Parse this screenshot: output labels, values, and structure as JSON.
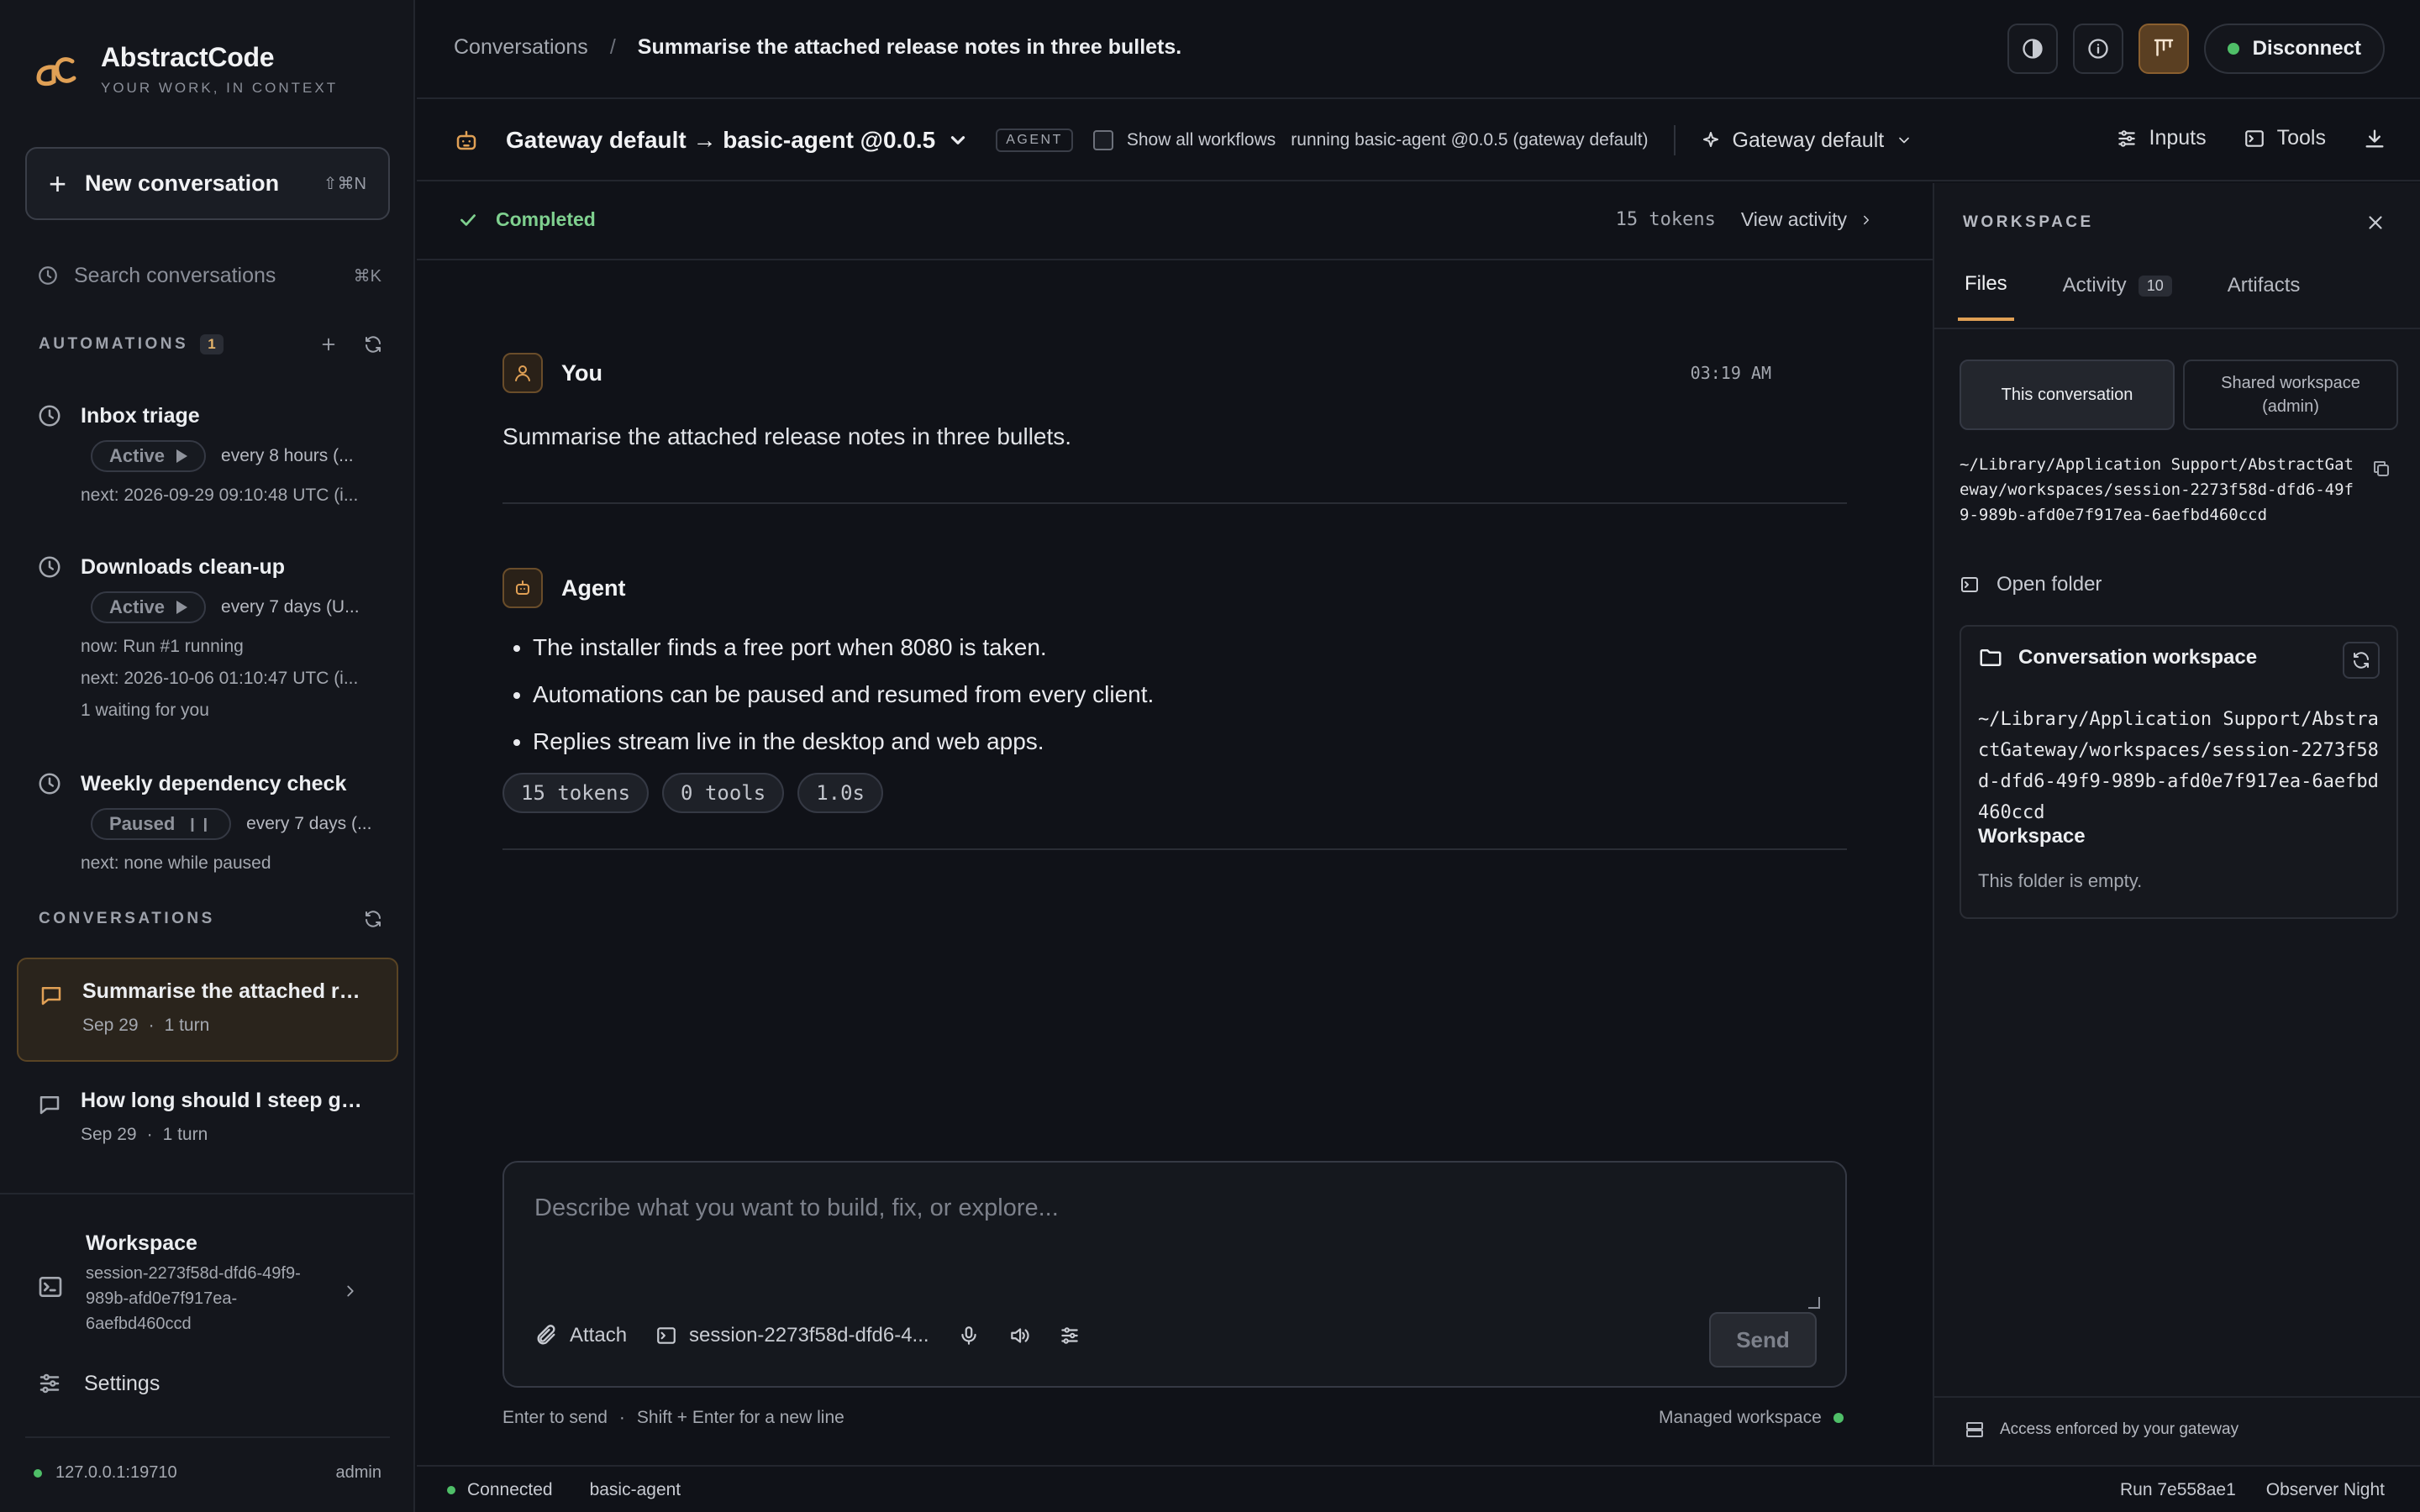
{
  "brand": {
    "name": "AbstractCode",
    "tagline": "YOUR WORK, IN CONTEXT"
  },
  "sidebar": {
    "new_conversation": {
      "label": "New conversation",
      "shortcut": "⇧⌘N"
    },
    "search": {
      "placeholder": "Search conversations",
      "shortcut": "⌘K"
    },
    "automations": {
      "heading": "AUTOMATIONS",
      "count": "1",
      "items": [
        {
          "title": "Inbox triage",
          "status": "Active",
          "schedule": "every 8 hours (...",
          "lines": [
            "next: 2026-09-29 09:10:48 UTC (i..."
          ]
        },
        {
          "title": "Downloads clean-up",
          "status": "Active",
          "schedule": "every 7 days (U...",
          "lines": [
            "now: Run #1 running",
            "next: 2026-10-06 01:10:47 UTC (i...",
            "1 waiting for you"
          ]
        },
        {
          "title": "Weekly dependency check",
          "status": "Paused",
          "schedule": "every 7 days (...",
          "lines": [
            "next: none while paused"
          ]
        }
      ]
    },
    "conversations": {
      "heading": "CONVERSATIONS",
      "items": [
        {
          "title": "Summarise the attached rel...",
          "date": "Sep 29",
          "turns": "1 turn"
        },
        {
          "title": "How long should I steep gre...",
          "date": "Sep 29",
          "turns": "1 turn"
        }
      ]
    },
    "workspace": {
      "title": "Workspace",
      "path": "session-2273f58d-dfd6-49f9-989b-afd0e7f917ea-6aefbd460ccd"
    },
    "settings_label": "Settings",
    "footer": {
      "host": "127.0.0.1:19710",
      "user": "admin"
    }
  },
  "topbar": {
    "breadcrumb_root": "Conversations",
    "breadcrumb_sep": "/",
    "breadcrumb_current": "Summarise the attached release notes in three bullets.",
    "disconnect_label": "Disconnect"
  },
  "agentbar": {
    "agent_name": "Gateway default → basic-agent @0.0.5",
    "badge": "AGENT",
    "show_all_label": "Show all workflows",
    "running_label": "running basic-agent @0.0.5 (gateway default)",
    "gateway_label": "Gateway default",
    "inputs_label": "Inputs",
    "tools_label": "Tools"
  },
  "statusbar": {
    "status": "Completed",
    "tokens": "15 tokens",
    "view_activity": "View activity"
  },
  "messages": {
    "user": {
      "role": "You",
      "time": "03:19 AM",
      "text": "Summarise the attached release notes in three bullets."
    },
    "agent": {
      "role": "Agent",
      "bullets": [
        "The installer finds a free port when 8080 is taken.",
        "Automations can be paused and resumed from every client.",
        "Replies stream live in the desktop and web apps."
      ],
      "chips": [
        "15 tokens",
        "0 tools",
        "1.0s"
      ]
    }
  },
  "composer": {
    "placeholder": "Describe what you want to build, fix, or explore...",
    "attach_label": "Attach",
    "session_label": "session-2273f58d-dfd6-4...",
    "send_label": "Send",
    "hint_send": "Enter to send",
    "hint_dot": "·",
    "hint_newline": "Shift + Enter for a new line",
    "managed_label": "Managed workspace"
  },
  "bottombar": {
    "connected": "Connected",
    "agent": "basic-agent",
    "run": "Run 7e558ae1",
    "theme": "Observer Night"
  },
  "workspace_panel": {
    "title": "WORKSPACE",
    "tabs": [
      {
        "label": "Files"
      },
      {
        "label": "Activity",
        "count": "10"
      },
      {
        "label": "Artifacts"
      }
    ],
    "segment_this": "This conversation",
    "segment_shared": "Shared workspace (admin)",
    "path": "~/Library/Application Support/AbstractGateway/workspaces/session-2273f58d-dfd6-49f9-989b-afd0e7f917ea-6aefbd460ccd",
    "open_folder": "Open folder",
    "card": {
      "title": "Conversation workspace",
      "path": "~/Library/Application Support/AbstractGateway/workspaces/session-2273f58d-dfd6-49f9-989b-afd0e7f917ea-6aefbd460ccd",
      "subtitle": "Workspace",
      "empty": "This folder is empty."
    },
    "footer": "Access enforced by your gateway"
  },
  "colors": {
    "accent": "#e0a055",
    "success": "#4fbf68",
    "background": "#101218"
  }
}
